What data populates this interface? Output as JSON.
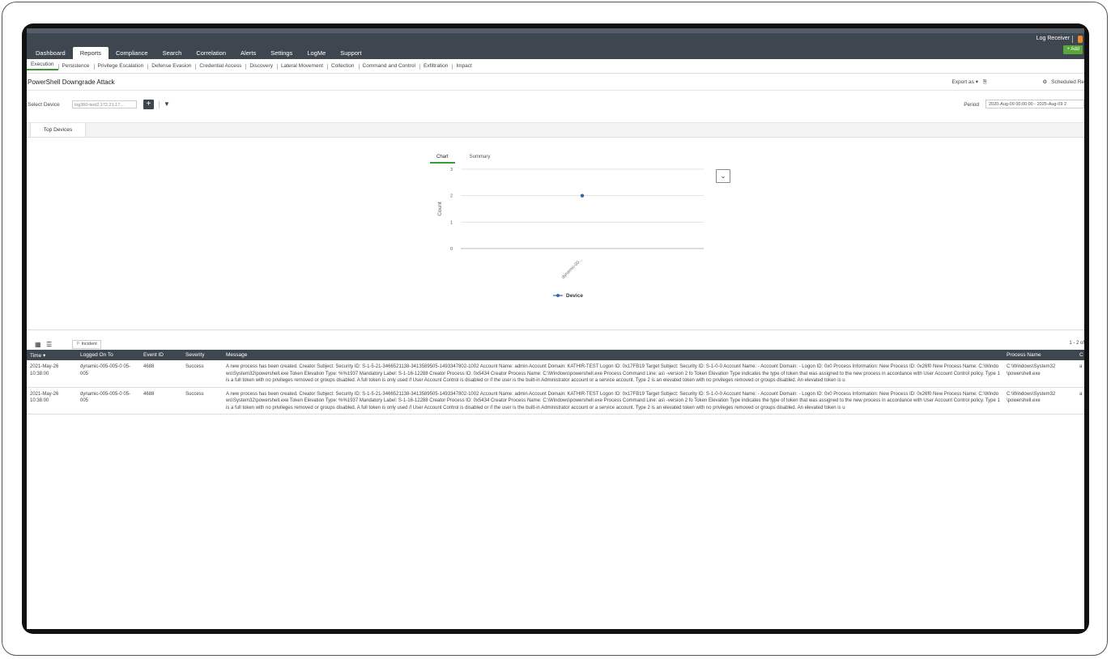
{
  "nav": {
    "items": [
      "Dashboard",
      "Reports",
      "Compliance",
      "Search",
      "Correlation",
      "Alerts",
      "Settings",
      "LogMe",
      "Support"
    ],
    "active": "Reports",
    "log_receiver": "Log Receiver",
    "add_label": "+ Add"
  },
  "subtabs": {
    "items": [
      "Execution",
      "Persistence",
      "Privilege Escalation",
      "Defense Evasion",
      "Credential Access",
      "Discovery",
      "Lateral Movement",
      "Collection",
      "Command and Control",
      "Exfiltration",
      "Impact"
    ],
    "active": "Execution"
  },
  "page": {
    "title": "PowerShell Downgrade Attack",
    "export_label": "Export as",
    "scheduled_label": "Scheduled Re"
  },
  "filters": {
    "select_device_label": "Select Device",
    "device_value": "log360-test2,172.21.17...",
    "period_label": "Period",
    "period_value": "2020-Aug-09 00:00:00 - 2025-Aug-09 2"
  },
  "panel": {
    "tab": "Top Devices",
    "chart_tabs": [
      "Chart",
      "Summary"
    ],
    "active_chart_tab": "Chart"
  },
  "chart_data": {
    "type": "line",
    "categories": [
      "dynamic-00..."
    ],
    "series": [
      {
        "name": "Device",
        "values": [
          2
        ]
      }
    ],
    "ylabel": "Count",
    "xlabel": "",
    "ylim": [
      0,
      3
    ],
    "yticks": [
      0,
      1,
      2,
      3
    ],
    "grid": true,
    "legend": "bottom",
    "color": "#2e6aa6"
  },
  "grid": {
    "incident_label": "Incident",
    "range": "1 - 2 of",
    "columns": [
      "Time",
      "Logged On To",
      "Event ID",
      "Severity",
      "Message",
      "Process Name",
      "C"
    ],
    "rows": [
      {
        "time": "2021-May-26 10:38:00",
        "logged_on_to": "dynamic-005-005-0 05-005",
        "event_id": "4688",
        "severity": "Success",
        "message": "A new process has been created. Creator Subject: Security ID: S-1-5-21-3466521138-3413589505-1493347802-1002 Account Name: admin Account Domain: KATHIR-TEST Logon ID: 0x17FB19 Target Subject: Security ID: S-1-0-0 Account Name: - Account Domain: - Logon ID: 0x0 Process Information: New Process ID: 0x26f0 New Process Name: C:\\Windows\\System32\\powershell.exe Token Elevation Type: %%1937 Mandatory Label: S-1-16-12288 Creator Process ID: 0x5434 Creator Process Name: C:\\Windows\\powershell.exe Process Command Line: as\\ -version 2 fo Token Elevation Type indicates the type of token that was assigned to the new process in accordance with User Account Control policy. Type 1 is a full token with no privileges removed or groups disabled. A full token is only used if User Account Control is disabled or if the user is the built-in Administrator account or a service account. Type 2 is an elevated token with no privileges removed or groups disabled. An elevated token is u",
        "process_name": "C:\\Windows\\System32 \\powershell.exe",
        "extra": "a"
      },
      {
        "time": "2021-May-26 10:38:00",
        "logged_on_to": "dynamic-005-005-0 05-005",
        "event_id": "4688",
        "severity": "Success",
        "message": "A new process has been created. Creator Subject: Security ID: S-1-5-21-3466521138-3413589505-1493347802-1002 Account Name: admin Account Domain: KATHIR-TEST Logon ID: 0x17FB19 Target Subject: Security ID: S-1-0-0 Account Name: - Account Domain: - Logon ID: 0x0 Process Information: New Process ID: 0x26f0 New Process Name: C:\\Windows\\System32\\powershell.exe Token Elevation Type: %%1937 Mandatory Label: S-1-16-12288 Creator Process ID: 0x5434 Creator Process Name: C:\\Windows\\powershell.exe Process Command Line: as\\ -version 2 fo Token Elevation Type indicates the type of token that was assigned to the new process in accordance with User Account Control policy. Type 1 is a full token with no privileges removed or groups disabled. A full token is only used if User Account Control is disabled or if the user is the built-in Administrator account or a service account. Type 2 is an elevated token with no privileges removed or groups disabled. An elevated token is u",
        "process_name": "C:\\Windows\\System32 \\powershell.exe",
        "extra": "a"
      }
    ]
  }
}
